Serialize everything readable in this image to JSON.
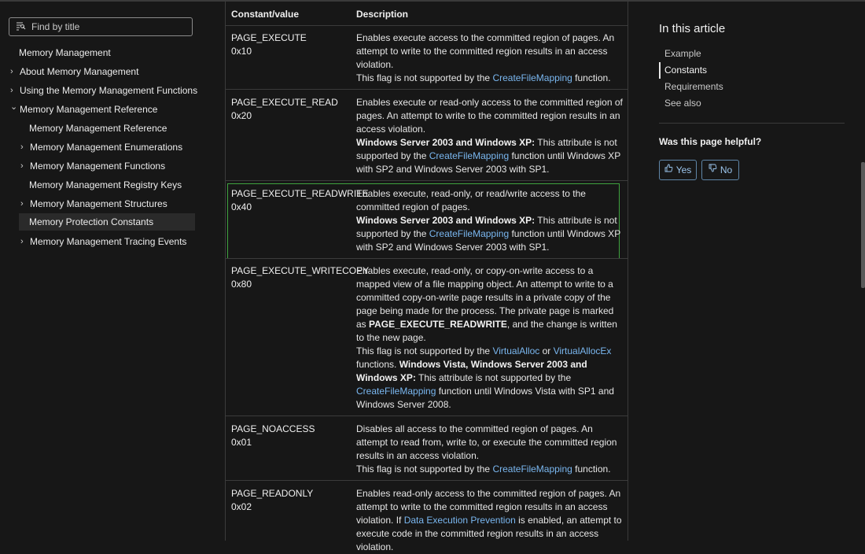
{
  "sidebar": {
    "filter_placeholder": "Find by title",
    "items": [
      {
        "label": "Memory Management",
        "chevron": ""
      },
      {
        "label": "About Memory Management",
        "chevron": "›"
      },
      {
        "label": "Using the Memory Management Functions",
        "chevron": "›"
      },
      {
        "label": "Memory Management Reference",
        "chevron": "⌄"
      },
      {
        "label": "Memory Management Reference",
        "chevron": ""
      },
      {
        "label": "Memory Management Enumerations",
        "chevron": "›"
      },
      {
        "label": "Memory Management Functions",
        "chevron": "›"
      },
      {
        "label": "Memory Management Registry Keys",
        "chevron": ""
      },
      {
        "label": "Memory Management Structures",
        "chevron": "›"
      },
      {
        "label": "Memory Protection Constants",
        "chevron": ""
      },
      {
        "label": "Memory Management Tracing Events",
        "chevron": "›"
      }
    ]
  },
  "table": {
    "col_constant": "Constant/value",
    "col_description": "Description",
    "rows": [
      {
        "name": "PAGE_EXECUTE",
        "value": "0x10",
        "d1": "Enables execute access to the committed region of pages. An attempt to write to the committed region results in an access violation.",
        "d2a": "This flag is not supported by the ",
        "d2link": "CreateFileMapping",
        "d2b": " function."
      },
      {
        "name": "PAGE_EXECUTE_READ",
        "value": "0x20",
        "d1": "Enables execute or read-only access to the committed region of pages. An attempt to write to the committed region results in an access violation.",
        "bold": "Windows Server 2003 and Windows XP:",
        "d2a": " This attribute is not supported by the ",
        "d2link": "CreateFileMapping",
        "d2b": " function until Windows XP with SP2 and Windows Server 2003 with SP1."
      },
      {
        "name": "PAGE_EXECUTE_READWRITE",
        "value": "0x40",
        "d1": "Enables execute, read-only, or read/write access to the committed region of pages.",
        "bold": "Windows Server 2003 and Windows XP:",
        "d2a": " This attribute is not supported by the ",
        "d2link": "CreateFileMapping",
        "d2b": " function until Windows XP with SP2 and Windows Server 2003 with SP1."
      },
      {
        "name": "PAGE_EXECUTE_WRITECOPY",
        "value": "0x80",
        "d1": "Enables execute, read-only, or copy-on-write access to a mapped view of a file mapping object. An attempt to write to a committed copy-on-write page results in a private copy of the page being made for the process. The private page is marked as ",
        "d1bold": "PAGE_EXECUTE_READWRITE",
        "d1b": ", and the change is written to the new page.",
        "d2a": "This flag is not supported by the ",
        "d2link": "VirtualAlloc",
        "d2or": " or ",
        "d2link2": "VirtualAllocEx",
        "d2b": " functions. ",
        "bold": "Windows Vista, Windows Server 2003 and Windows XP:",
        "d3a": " This attribute is not supported by the ",
        "d3link": "CreateFileMapping",
        "d3b": " function until Windows Vista with SP1 and Windows Server 2008."
      },
      {
        "name": "PAGE_NOACCESS",
        "value": "0x01",
        "d1": "Disables all access to the committed region of pages. An attempt to read from, write to, or execute the committed region results in an access violation.",
        "d2a": "This flag is not supported by the ",
        "d2link": "CreateFileMapping",
        "d2b": " function."
      },
      {
        "name": "PAGE_READONLY",
        "value": "0x02",
        "d1": "Enables read-only access to the committed region of pages. An attempt to write to the committed region results in an access violation. If ",
        "d1link": "Data Execution Prevention",
        "d1b": " is enabled, an attempt to execute code in the committed region results in an access violation."
      }
    ]
  },
  "article": {
    "title": "In this article",
    "links": [
      "Example",
      "Constants",
      "Requirements",
      "See also"
    ],
    "helpful_question": "Was this page helpful?",
    "yes_label": "Yes",
    "no_label": "No"
  }
}
